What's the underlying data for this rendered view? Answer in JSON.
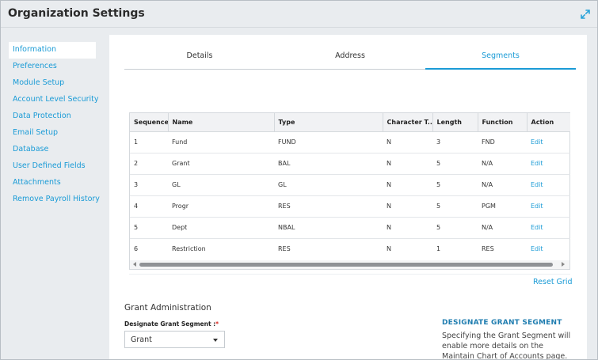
{
  "header": {
    "title": "Organization Settings",
    "expand_icon": "expand-arrows-icon"
  },
  "sidebar": {
    "items": [
      {
        "label": "Information",
        "active": true
      },
      {
        "label": "Preferences"
      },
      {
        "label": "Module Setup"
      },
      {
        "label": "Account Level Security"
      },
      {
        "label": "Data Protection"
      },
      {
        "label": "Email Setup"
      },
      {
        "label": "Database"
      },
      {
        "label": "User Defined Fields"
      },
      {
        "label": "Attachments"
      },
      {
        "label": "Remove Payroll History"
      }
    ]
  },
  "tabs": [
    {
      "label": "Details"
    },
    {
      "label": "Address"
    },
    {
      "label": "Segments",
      "active": true
    }
  ],
  "grid": {
    "columns": [
      "Sequence",
      "Name",
      "Type",
      "Character T...",
      "Length",
      "Function",
      "Action"
    ],
    "rows": [
      [
        "1",
        "Fund",
        "FUND",
        "N",
        "3",
        "FND",
        "Edit"
      ],
      [
        "2",
        "Grant",
        "BAL",
        "N",
        "5",
        "N/A",
        "Edit"
      ],
      [
        "3",
        "GL",
        "GL",
        "N",
        "5",
        "N/A",
        "Edit"
      ],
      [
        "4",
        "Progr",
        "RES",
        "N",
        "5",
        "PGM",
        "Edit"
      ],
      [
        "5",
        "Dept",
        "NBAL",
        "N",
        "5",
        "N/A",
        "Edit"
      ],
      [
        "6",
        "Restriction",
        "RES",
        "N",
        "1",
        "RES",
        "Edit"
      ]
    ],
    "reset_label": "Reset Grid"
  },
  "grant_admin": {
    "section_title": "Grant Administration",
    "field_label": "Designate Grant Segment :",
    "required_mark": "*",
    "selected_value": "Grant"
  },
  "help": {
    "title": "DESIGNATE GRANT SEGMENT",
    "text": "Specifying the Grant Segment will enable more details on the Maintain Chart of Accounts page. Enter details"
  },
  "colors": {
    "accent": "#1a9bd6",
    "background": "#e9ecef",
    "panel": "#ffffff",
    "required": "#d9241d"
  }
}
